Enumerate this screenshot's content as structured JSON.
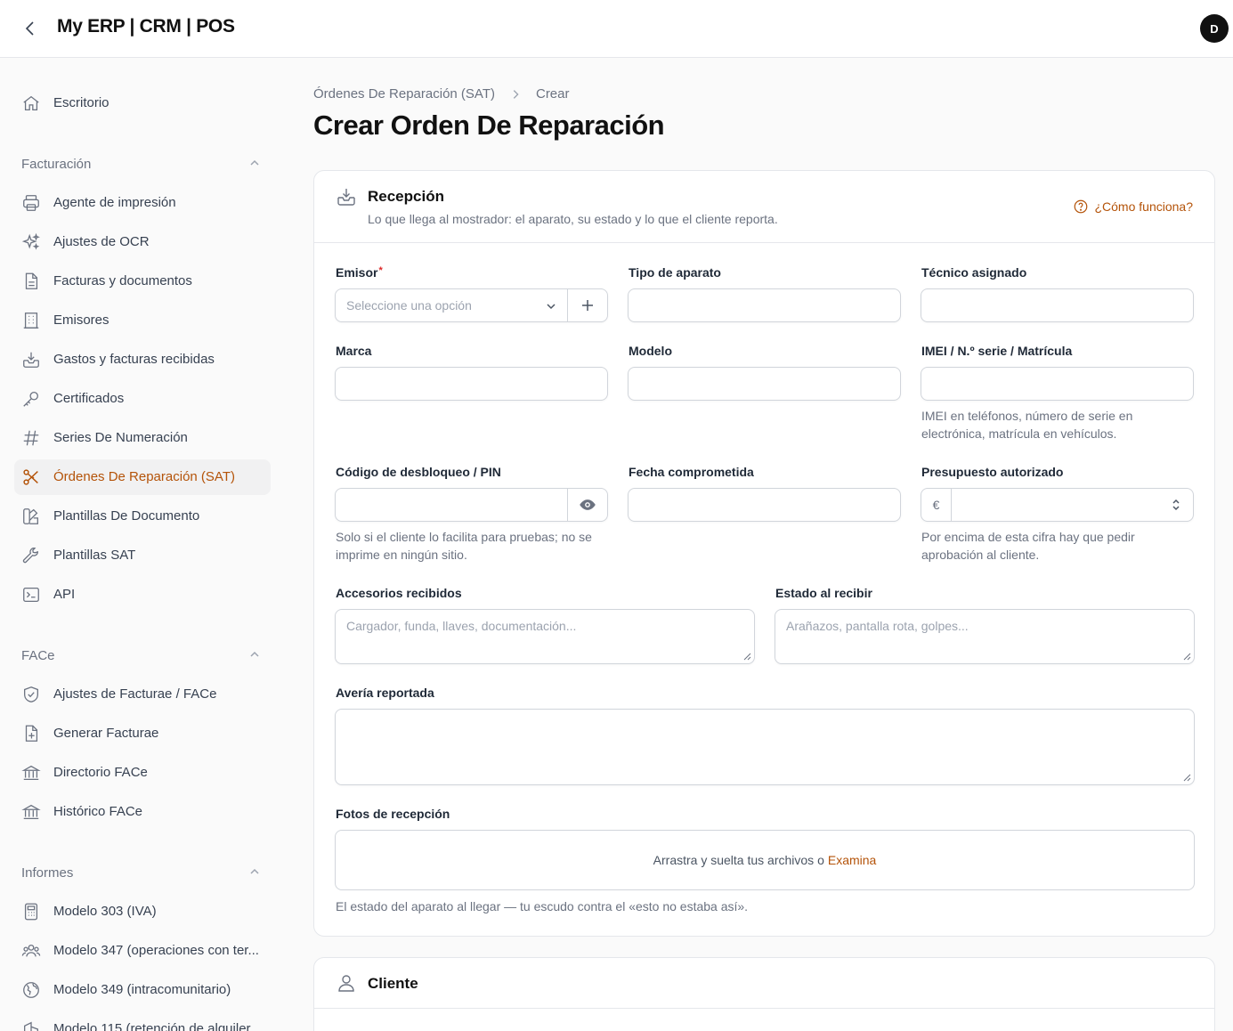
{
  "app": {
    "title": "My ERP | CRM | POS",
    "avatar_initial": "D"
  },
  "sidebar": {
    "top_item": {
      "label": "Escritorio",
      "icon": "home-icon"
    },
    "groups": [
      {
        "label": "Facturación",
        "items": [
          {
            "label": "Agente de impresión",
            "icon": "printer-icon"
          },
          {
            "label": "Ajustes de OCR",
            "icon": "sparkles-icon"
          },
          {
            "label": "Facturas y documentos",
            "icon": "document-icon"
          },
          {
            "label": "Emisores",
            "icon": "building-icon"
          },
          {
            "label": "Gastos y facturas recibidas",
            "icon": "inbox-download-icon"
          },
          {
            "label": "Certificados",
            "icon": "key-icon"
          },
          {
            "label": "Series De Numeración",
            "icon": "hashtag-icon"
          },
          {
            "label": "Órdenes De Reparación (SAT)",
            "icon": "scissors-wrench-icon",
            "active": true
          },
          {
            "label": "Plantillas De Documento",
            "icon": "swatch-icon"
          },
          {
            "label": "Plantillas SAT",
            "icon": "wrench-icon"
          },
          {
            "label": "API",
            "icon": "terminal-icon"
          }
        ]
      },
      {
        "label": "FACe",
        "items": [
          {
            "label": "Ajustes de Facturae / FACe",
            "icon": "shield-check-icon"
          },
          {
            "label": "Generar Facturae",
            "icon": "document-plus-icon"
          },
          {
            "label": "Directorio FACe",
            "icon": "bank-icon"
          },
          {
            "label": "Histórico FACe",
            "icon": "bank-icon"
          }
        ]
      },
      {
        "label": "Informes",
        "items": [
          {
            "label": "Modelo 303 (IVA)",
            "icon": "calculator-icon"
          },
          {
            "label": "Modelo 347 (operaciones con ter...",
            "icon": "users-group-icon"
          },
          {
            "label": "Modelo 349 (intracomunitario)",
            "icon": "globe-icon"
          },
          {
            "label": "Modelo 115 (retención de alquiler...",
            "icon": "home-modern-icon"
          }
        ]
      }
    ]
  },
  "breadcrumb": {
    "parent": "Órdenes De Reparación (SAT)",
    "current": "Crear"
  },
  "page_title": "Crear Orden De Reparación",
  "reception": {
    "title": "Recepción",
    "description": "Lo que llega al mostrador: el aparato, su estado y lo que el cliente reporta.",
    "help_link": "¿Cómo funciona?",
    "fields": {
      "emisor": {
        "label": "Emisor",
        "required_mark": "*",
        "placeholder": "Seleccione una opción"
      },
      "tipo_aparato": {
        "label": "Tipo de aparato"
      },
      "tecnico": {
        "label": "Técnico asignado"
      },
      "marca": {
        "label": "Marca"
      },
      "modelo": {
        "label": "Modelo"
      },
      "imei": {
        "label": "IMEI / N.º serie / Matrícula",
        "hint": "IMEI en teléfonos, número de serie en electrónica, matrícula en vehículos."
      },
      "pin": {
        "label": "Código de desbloqueo / PIN",
        "hint": "Solo si el cliente lo facilita para pruebas; no se imprime en ningún sitio."
      },
      "fecha": {
        "label": "Fecha comprometida"
      },
      "presupuesto": {
        "label": "Presupuesto autorizado",
        "currency": "€",
        "hint": "Por encima de esta cifra hay que pedir aprobación al cliente."
      },
      "accesorios": {
        "label": "Accesorios recibidos",
        "placeholder": "Cargador, funda, llaves, documentación..."
      },
      "estado": {
        "label": "Estado al recibir",
        "placeholder": "Arañazos, pantalla rota, golpes..."
      },
      "averia": {
        "label": "Avería reportada"
      },
      "fotos": {
        "label": "Fotos de recepción",
        "drop_text": "Arrastra y suelta tus archivos o",
        "browse": "Examina",
        "hint": "El estado del aparato al llegar — tu escudo contra el «esto no estaba así»."
      }
    }
  },
  "client": {
    "title": "Cliente"
  }
}
